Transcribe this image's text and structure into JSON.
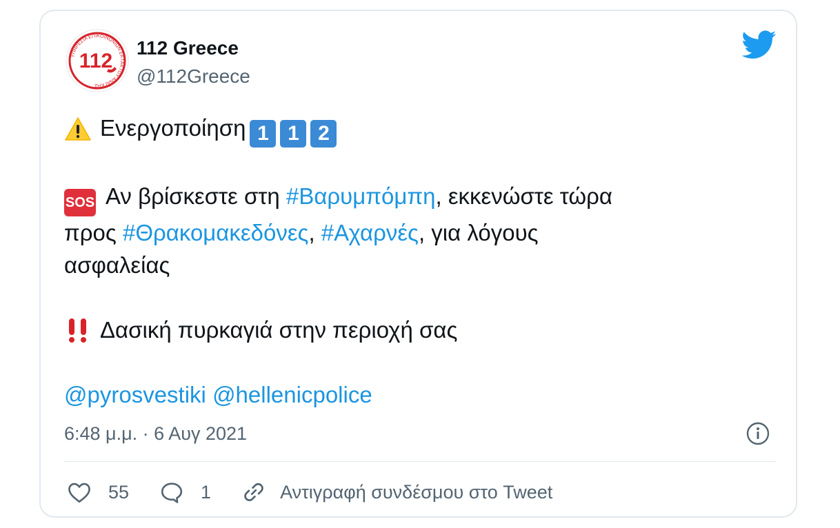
{
  "tweet": {
    "author_name": "112 Greece",
    "author_handle": "@112Greece",
    "avatar": {
      "number": "112",
      "ring_text": "ΥΠΗΡΕΣΙΑ ΕΠΙΚΟΙΝΩΝΙΩΝ ΕΚΤΑΚΤΟΥ ΑΝΑΓΚΗΣ",
      "color": "#d7242b"
    },
    "lines": {
      "l1_text": "Ενεργοποίηση",
      "l1_keys": [
        "1",
        "1",
        "2"
      ],
      "sos_label": "SOS",
      "l2_a": "Αν βρίσκεστε στη ",
      "l2_tag": "#Βαρυμπόμπη",
      "l2_b": ", εκκενώστε τώρα",
      "l3_a": "προς ",
      "l3_tag1": "#Θρακομακεδόνες",
      "l3_sep": ", ",
      "l3_tag2": "#Αχαρνές",
      "l3_b": ", για λόγους",
      "l4": "ασφαλείας",
      "l5": "Δασική πυρκαγιά στην περιοχή σας",
      "mention1": "@pyrosvestiki",
      "mention2": "@hellenicpolice"
    },
    "timestamp": "6:48 μ.μ. · 6 Αυγ 2021",
    "likes": "55",
    "replies": "1",
    "copy_link": "Αντιγραφή συνδέσμου στο Tweet"
  },
  "icons": {
    "brand": "twitter-bird-icon",
    "warning": "warning-icon",
    "sos": "sos-icon",
    "alert": "double-exclamation-icon",
    "info": "info-icon",
    "like": "heart-icon",
    "reply": "reply-bubble-icon",
    "copy": "link-icon"
  },
  "colors": {
    "link": "#1b95e0",
    "muted": "#536471",
    "keycap": "#3b8ad6",
    "sos": "#e0303b",
    "alert": "#d8232a",
    "twitter": "#1d9bf0"
  }
}
